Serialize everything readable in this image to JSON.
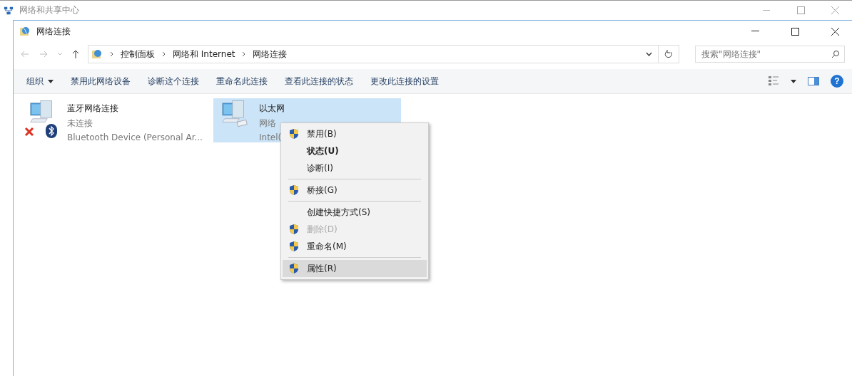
{
  "background_window": {
    "title": "网络和共享中心"
  },
  "window": {
    "title": "网络连接"
  },
  "address_bar": {
    "path": [
      "控制面板",
      "网络和 Internet",
      "网络连接"
    ]
  },
  "search": {
    "placeholder": "搜索\"网络连接\""
  },
  "toolbar": {
    "items": [
      {
        "label": "组织",
        "kind": "dropdown"
      },
      {
        "label": "禁用此网络设备",
        "kind": "command"
      },
      {
        "label": "诊断这个连接",
        "kind": "command"
      },
      {
        "label": "重命名此连接",
        "kind": "command"
      },
      {
        "label": "查看此连接的状态",
        "kind": "command"
      },
      {
        "label": "更改此连接的设置",
        "kind": "command"
      }
    ],
    "help": "?"
  },
  "connections": [
    {
      "name": "蓝牙网络连接",
      "status": "未连接",
      "device": "Bluetooth Device (Personal Ar...",
      "selected": false,
      "connected": false,
      "bluetooth": true
    },
    {
      "name": "以太网",
      "status": "网络",
      "device": "Intel(",
      "selected": true,
      "connected": true,
      "bluetooth": false
    }
  ],
  "context_menu": {
    "items": [
      {
        "kind": "item",
        "label": "禁用(B)",
        "shield": true,
        "default": false,
        "disabled": false,
        "selected": false
      },
      {
        "kind": "item",
        "label": "状态(U)",
        "shield": false,
        "default": true,
        "disabled": false,
        "selected": false
      },
      {
        "kind": "item",
        "label": "诊断(I)",
        "shield": false,
        "default": false,
        "disabled": false,
        "selected": false
      },
      {
        "kind": "separator"
      },
      {
        "kind": "item",
        "label": "桥接(G)",
        "shield": true,
        "default": false,
        "disabled": false,
        "selected": false
      },
      {
        "kind": "separator"
      },
      {
        "kind": "item",
        "label": "创建快捷方式(S)",
        "shield": false,
        "default": false,
        "disabled": false,
        "selected": false
      },
      {
        "kind": "item",
        "label": "删除(D)",
        "shield": true,
        "default": false,
        "disabled": true,
        "selected": false
      },
      {
        "kind": "item",
        "label": "重命名(M)",
        "shield": true,
        "default": false,
        "disabled": false,
        "selected": false
      },
      {
        "kind": "separator"
      },
      {
        "kind": "item",
        "label": "属性(R)",
        "shield": true,
        "default": false,
        "disabled": false,
        "selected": true
      }
    ]
  }
}
